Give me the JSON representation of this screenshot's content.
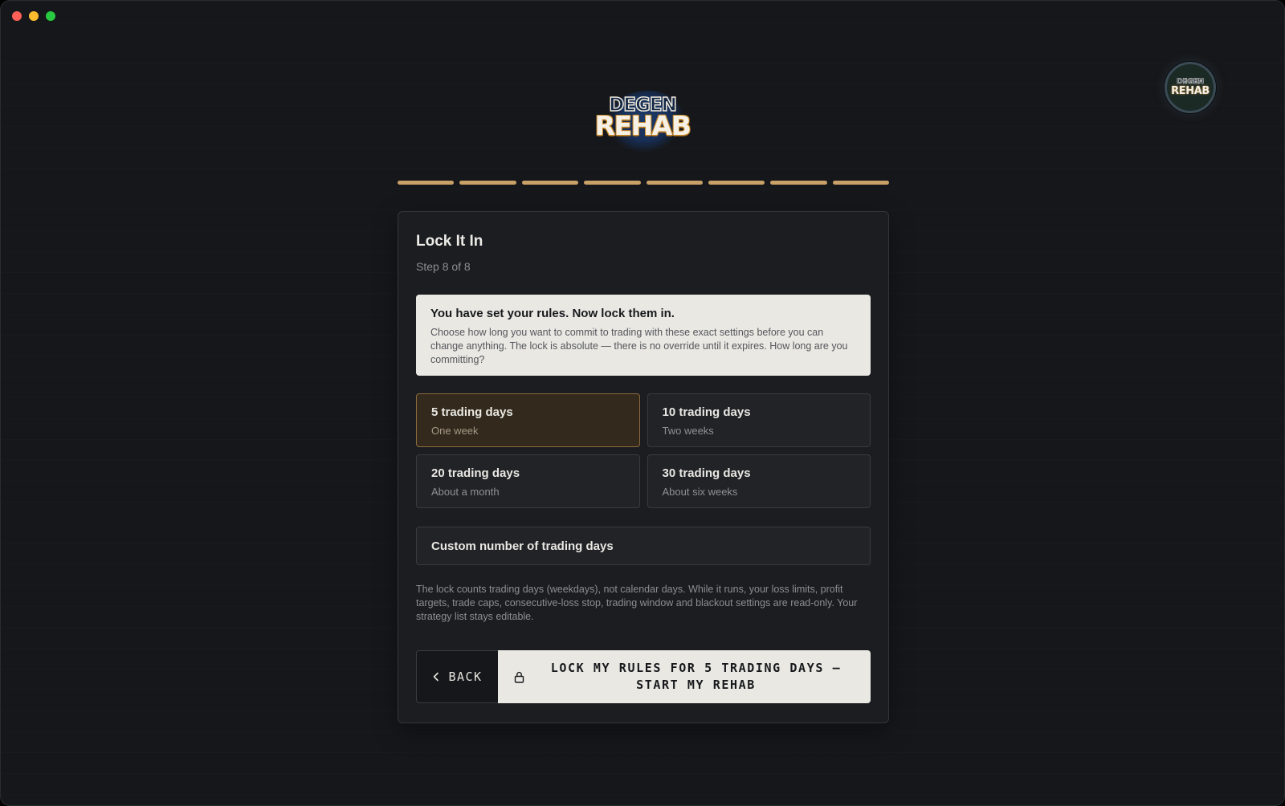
{
  "brand": {
    "logo_line1": "DEGEN",
    "logo_line2": "REHAB"
  },
  "avatar": {
    "line1": "DEGEN",
    "line2": "REHAB"
  },
  "progress": {
    "total_steps": 8,
    "completed_steps": 8,
    "color": "#c9a068"
  },
  "step": {
    "title": "Lock It In",
    "subtitle": "Step 8 of 8"
  },
  "notice": {
    "heading": "You have set your rules. Now lock them in.",
    "body": "Choose how long you want to commit to trading with these exact settings before you can change anything. The lock is absolute — there is no override until it expires. How long are you committing?"
  },
  "options": [
    {
      "title": "5 trading days",
      "subtitle": "One week",
      "selected": true
    },
    {
      "title": "10 trading days",
      "subtitle": "Two weeks",
      "selected": false
    },
    {
      "title": "20 trading days",
      "subtitle": "About a month",
      "selected": false
    },
    {
      "title": "30 trading days",
      "subtitle": "About six weeks",
      "selected": false
    }
  ],
  "custom_option": {
    "label": "Custom number of trading days"
  },
  "footnote": "The lock counts trading days (weekdays), not calendar days. While it runs, your loss limits, profit targets, trade caps, consecutive-loss stop, trading window and blackout settings are read-only. Your strategy list stays editable.",
  "actions": {
    "back_label": "BACK",
    "back_icon": "chevron-left-icon",
    "lock_label": "LOCK MY RULES FOR 5 TRADING DAYS — START MY REHAB",
    "lock_icon": "lock-icon"
  },
  "colors": {
    "background": "#16171a",
    "card": "#1c1d21",
    "selected_option": "#33291c",
    "accent": "#c9a068",
    "primary_button": "#e9e8e3"
  }
}
